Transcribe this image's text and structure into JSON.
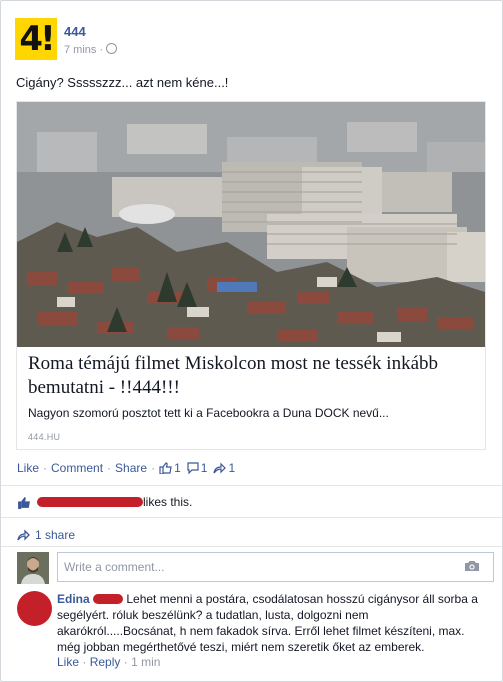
{
  "post": {
    "page_name": "444",
    "logo_text": "4!",
    "time": "7 mins ·",
    "privacy_icon": "globe-icon",
    "status_text": "Cigány? Ssssszzz... azt nem kéne...!"
  },
  "link": {
    "title": "Roma témájú filmet Miskolcon most ne tessék inkább bemutatni - !!444!!!",
    "description": "Nagyon szomorú posztot tett ki a Facebookra a Duna DOCK nevű...",
    "host": "444.HU"
  },
  "actions": {
    "like": "Like",
    "comment": "Comment",
    "share": "Share",
    "like_count": "1",
    "comment_count": "1",
    "share_count": "1"
  },
  "likes_line": {
    "suffix": "likes this."
  },
  "shares_line": {
    "text": "1 share"
  },
  "write_comment": {
    "placeholder": "Write a comment..."
  },
  "comment": {
    "author": "Edina",
    "text": "Lehet menni a postára, csodálatosan hosszú cigánysor áll sorba a segélyért. róluk beszélünk? a tudatlan, lusta, dolgozni nem akarókról.....Bocsánat, h nem fakadok sírva. Erről lehet filmet készíteni, max. még jobban megérthetővé teszi, miért nem szeretik őket az emberek.",
    "like": "Like",
    "reply": "Reply",
    "time": "1 min"
  },
  "colors": {
    "link_blue": "#3b5998",
    "logo_yellow": "#ffd600",
    "redaction_red": "#c4202a"
  }
}
